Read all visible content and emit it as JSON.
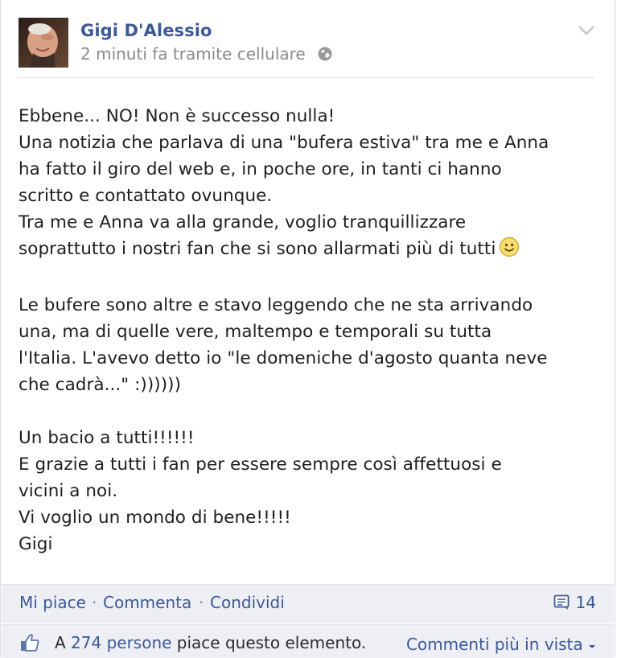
{
  "post": {
    "author": "Gigi D'Alessio",
    "meta": "2 minuti fa tramite cellulare",
    "body": {
      "line1": "Ebbene... NO! Non è successo nulla!",
      "line2": "Una notizia che parlava di una \"bufera estiva\" tra me e Anna",
      "line3": "ha fatto il giro del web e, in poche ore, in tanti ci hanno",
      "line4": "scritto e contattato ovunque.",
      "line5": "Tra me e Anna va alla grande, voglio tranquillizzare",
      "line6": "soprattutto i nostri fan che si sono allarmati più di tutti",
      "line7": "Le bufere sono altre e stavo leggendo che ne sta arrivando",
      "line8": "una, ma di quelle vere, maltempo e temporali su tutta",
      "line9": "l'Italia. L'avevo detto io \"le domeniche d'agosto quanta neve",
      "line10": "che cadrà...\" :))))))",
      "line11": "Un bacio a tutti!!!!!!",
      "line12": "E grazie a tutti i fan per essere sempre così affettuosi e",
      "line13": "vicini a noi.",
      "line14": "Vi voglio un mondo di bene!!!!!",
      "line15": "Gigi"
    }
  },
  "actions": {
    "like": "Mi piace",
    "separator": "·",
    "comment": "Commenta",
    "share": "Condividi",
    "comment_count": "14"
  },
  "likes": {
    "prefix": "A",
    "count_link": "274 persone",
    "suffix": "piace questo elemento.",
    "sort": "Commenti più in vista"
  },
  "colors": {
    "link": "#3b5998",
    "meta": "#8a8a8a",
    "footer_bg": "#edeff5"
  }
}
